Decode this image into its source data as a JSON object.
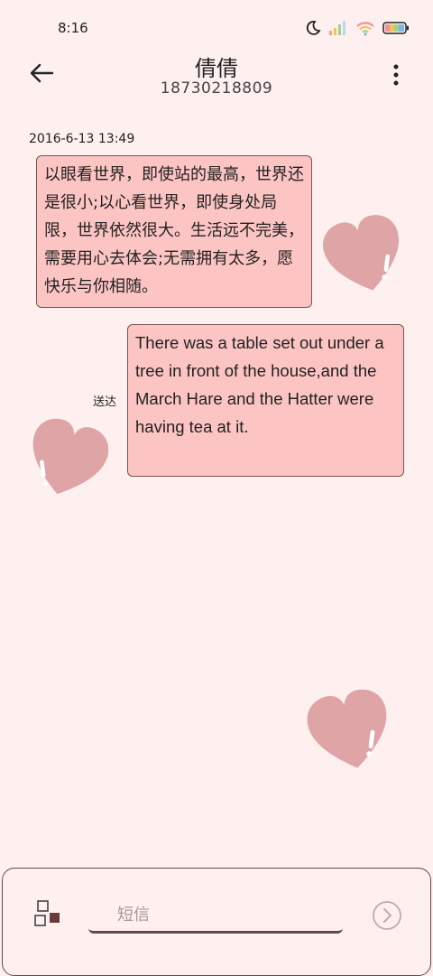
{
  "status_bar": {
    "time": "8:16",
    "icons": [
      "moon-icon",
      "signal-icon",
      "wifi-icon",
      "battery-icon"
    ]
  },
  "header": {
    "back_icon": "arrow-left-icon",
    "contact_name": "倩倩",
    "phone_number": "18730218809",
    "more_icon": "more-vertical-icon"
  },
  "conversation": {
    "timestamp": "2016-6-13 13:49",
    "messages": [
      {
        "direction": "incoming",
        "text": "以眼看世界，即使站的最高，世界还是很小;以心看世界，即使身处局限，世界依然很大。生活远不完美，需要用心去体会;无需拥有太多，愿快乐与你相随。"
      },
      {
        "direction": "outgoing",
        "text": "There was a table set out under a tree in front of the house,and the March Hare and the Hatter were having tea at it.",
        "status": "送达"
      }
    ]
  },
  "composer": {
    "attach_icon": "attach-icon",
    "placeholder": "短信",
    "value": "",
    "send_icon": "send-icon"
  },
  "colors": {
    "background": "#fdf0ef",
    "bubble": "#fcc5c3",
    "bubble_border": "#7a5353",
    "heart": "#dfa5a6",
    "accent": "#6b4646"
  }
}
